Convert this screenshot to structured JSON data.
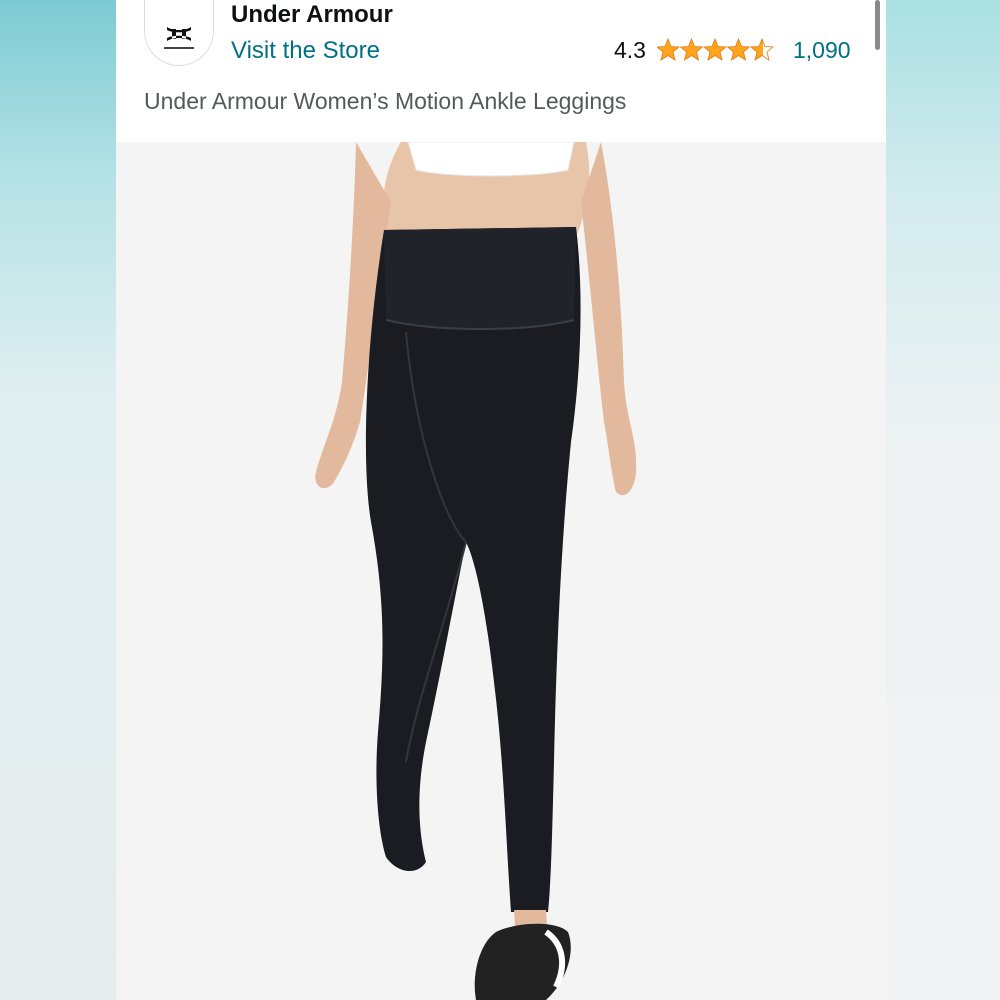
{
  "store": {
    "brand_name": "Under Armour",
    "visit_label": "Visit the Store"
  },
  "rating": {
    "value": "4.3",
    "stars": 4.3,
    "review_count": "1,090"
  },
  "product": {
    "title": "Under Armour Women’s Motion Ankle Leggings"
  },
  "icons": {
    "logo": "under-armour-logo",
    "rating": "star-rating-icon"
  },
  "colors": {
    "link": "#007185",
    "star": "#FFA41C"
  }
}
